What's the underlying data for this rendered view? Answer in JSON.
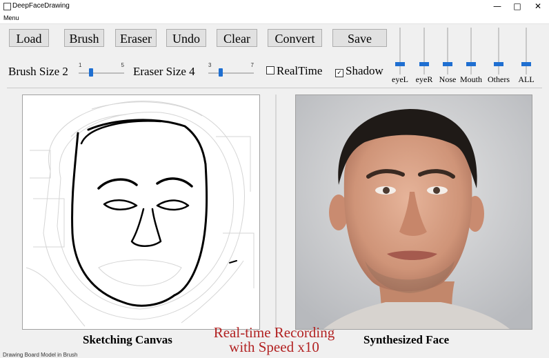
{
  "window": {
    "title": "DeepFaceDrawing"
  },
  "menu": {
    "items": [
      "Menu"
    ]
  },
  "toolbar": {
    "load": "Load",
    "brush": "Brush",
    "eraser": "Eraser",
    "undo": "Undo",
    "clear": "Clear",
    "convert": "Convert",
    "save": "Save"
  },
  "controls": {
    "brush_size": {
      "label": "Brush Size 2",
      "min": "1",
      "max": "5",
      "value": 2
    },
    "eraser_size": {
      "label": "Eraser Size 4",
      "min": "3",
      "max": "7",
      "value": 4
    },
    "realtime": {
      "label": "RealTime",
      "checked": false
    },
    "shadow": {
      "label": "Shadow",
      "checked": true
    }
  },
  "sliders": [
    {
      "label": "eyeL",
      "level": 0.2
    },
    {
      "label": "eyeR",
      "level": 0.2
    },
    {
      "label": "Nose",
      "level": 0.2
    },
    {
      "label": "Mouth",
      "level": 0.2
    },
    {
      "label": "Others",
      "level": 0.2
    },
    {
      "label": "ALL",
      "level": 0.2
    }
  ],
  "panels": {
    "left_caption": "Sketching Canvas",
    "right_caption": "Synthesized Face"
  },
  "overlay": {
    "line1": "Real-time Recording",
    "line2": "with Speed x10"
  },
  "status": {
    "text": "Drawing Board Model in Brush"
  },
  "colors": {
    "accent": "#1f6fd1",
    "overlay_text": "#b22222"
  }
}
